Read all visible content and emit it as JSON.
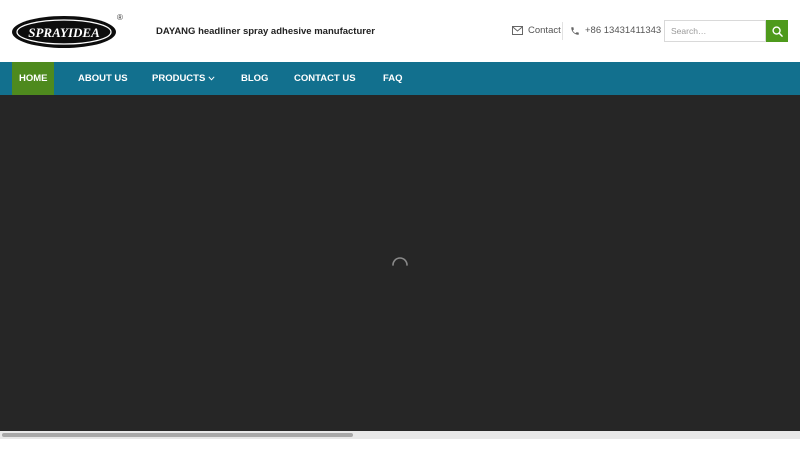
{
  "header": {
    "logo_text": "SPRAYIDEA",
    "logo_mark": "®",
    "tagline": "DAYANG headliner spray adhesive manufacturer",
    "contact_label": "Contact",
    "phone_label": "+86 13431411343",
    "search": {
      "placeholder": "Search…",
      "value": ""
    }
  },
  "nav": {
    "items": [
      {
        "label": "HOME",
        "active": true
      },
      {
        "label": "ABOUT US"
      },
      {
        "label": "PRODUCTS",
        "has_dropdown": true
      },
      {
        "label": "BLOG"
      },
      {
        "label": "CONTACT US"
      },
      {
        "label": "FAQ"
      }
    ]
  },
  "hero": {
    "state": "loading"
  },
  "scrollbar": {
    "horizontal_position": 0,
    "visible_fraction": 0.44
  },
  "colors": {
    "nav_bg": "#12708e",
    "nav_active_bg": "#4e8a1e",
    "search_button_bg": "#4e9a1c",
    "hero_bg": "#262626",
    "text_dark": "#222222",
    "text_muted": "#555555"
  },
  "icons": {
    "contact": "envelope-icon",
    "phone": "phone-icon",
    "search": "search-icon",
    "products_dropdown": "chevron-down-icon",
    "loading": "spinner-icon"
  }
}
